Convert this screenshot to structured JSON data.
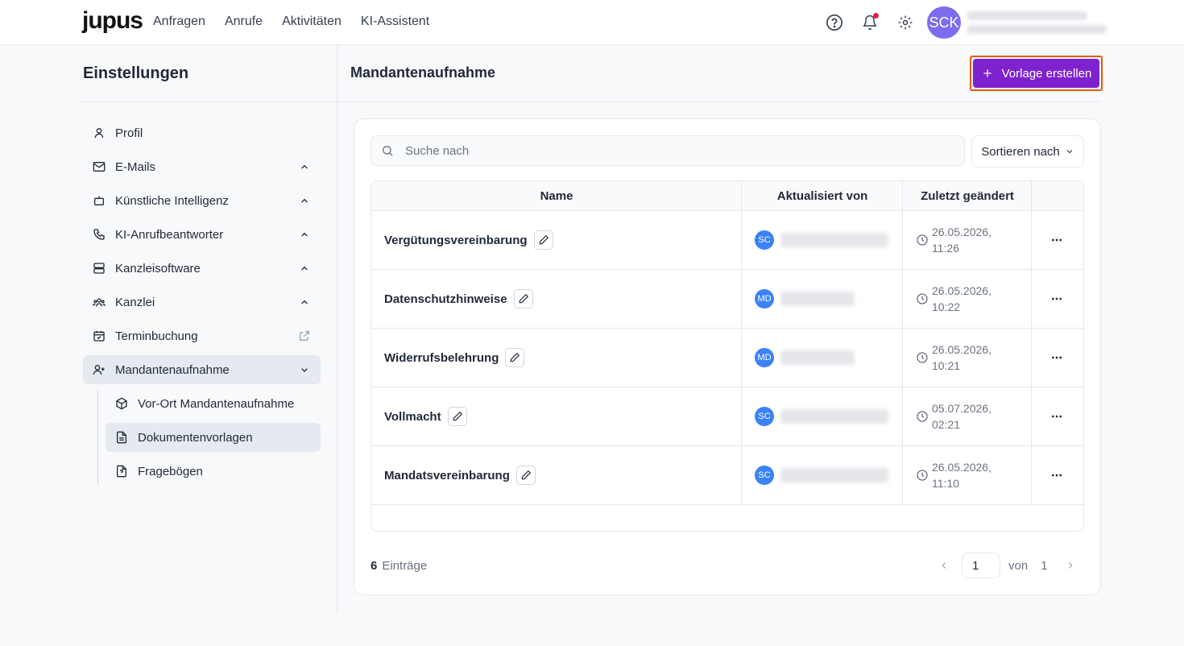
{
  "topbar": {
    "logo": "jupus",
    "nav": [
      "Anfragen",
      "Anrufe",
      "Aktivitäten",
      "KI-Assistent"
    ],
    "avatar_initials": "SCK"
  },
  "sidebar": {
    "title": "Einstellungen",
    "items": [
      {
        "label": "Profil",
        "icon": "user-icon"
      },
      {
        "label": "E-Mails",
        "icon": "mail-icon"
      },
      {
        "label": "Künstliche Intelligenz",
        "icon": "bot-icon"
      },
      {
        "label": "KI-Anrufbeantworter",
        "icon": "phone-icon"
      },
      {
        "label": "Kanzleisoftware",
        "icon": "server-icon"
      },
      {
        "label": "Kanzlei",
        "icon": "users-icon"
      },
      {
        "label": "Terminbuchung",
        "icon": "calendar-check-icon"
      },
      {
        "label": "Mandantenaufnahme",
        "icon": "user-plus-icon"
      }
    ],
    "subitems": [
      {
        "label": "Vor-Ort Mandantenaufnahme",
        "icon": "package-icon"
      },
      {
        "label": "Dokumentenvorlagen",
        "icon": "file-text-icon"
      },
      {
        "label": "Fragebögen",
        "icon": "file-question-icon"
      }
    ]
  },
  "main": {
    "title": "Mandantenaufnahme",
    "create_button": "Vorlage erstellen",
    "search_placeholder": "Suche nach",
    "sort_label": "Sortieren nach",
    "columns": [
      "Name",
      "Aktualisiert von",
      "Zuletzt geändert"
    ],
    "rows": [
      {
        "name": "Vergütungsvereinbarung",
        "user_initials": "SC",
        "date": "26.05.2026,",
        "time": "11:26"
      },
      {
        "name": "Datenschutzhinweise",
        "user_initials": "MD",
        "date": "26.05.2026,",
        "time": "10:22"
      },
      {
        "name": "Widerrufsbelehrung",
        "user_initials": "MD",
        "date": "26.05.2026,",
        "time": "10:21"
      },
      {
        "name": "Vollmacht",
        "user_initials": "SC",
        "date": "05.07.2026,",
        "time": "02:21"
      },
      {
        "name": "Mandatsvereinbarung",
        "user_initials": "SC",
        "date": "26.05.2026,",
        "time": "11:10"
      }
    ],
    "footer": {
      "count": "6",
      "count_label": "Einträge",
      "page": "1",
      "of_label": "von",
      "total_pages": "1"
    }
  },
  "colors": {
    "accent": "#7e22ce",
    "highlight_border": "#ea580c",
    "avatar": "#7c6cf0",
    "user_badge": "#3b82f6"
  }
}
